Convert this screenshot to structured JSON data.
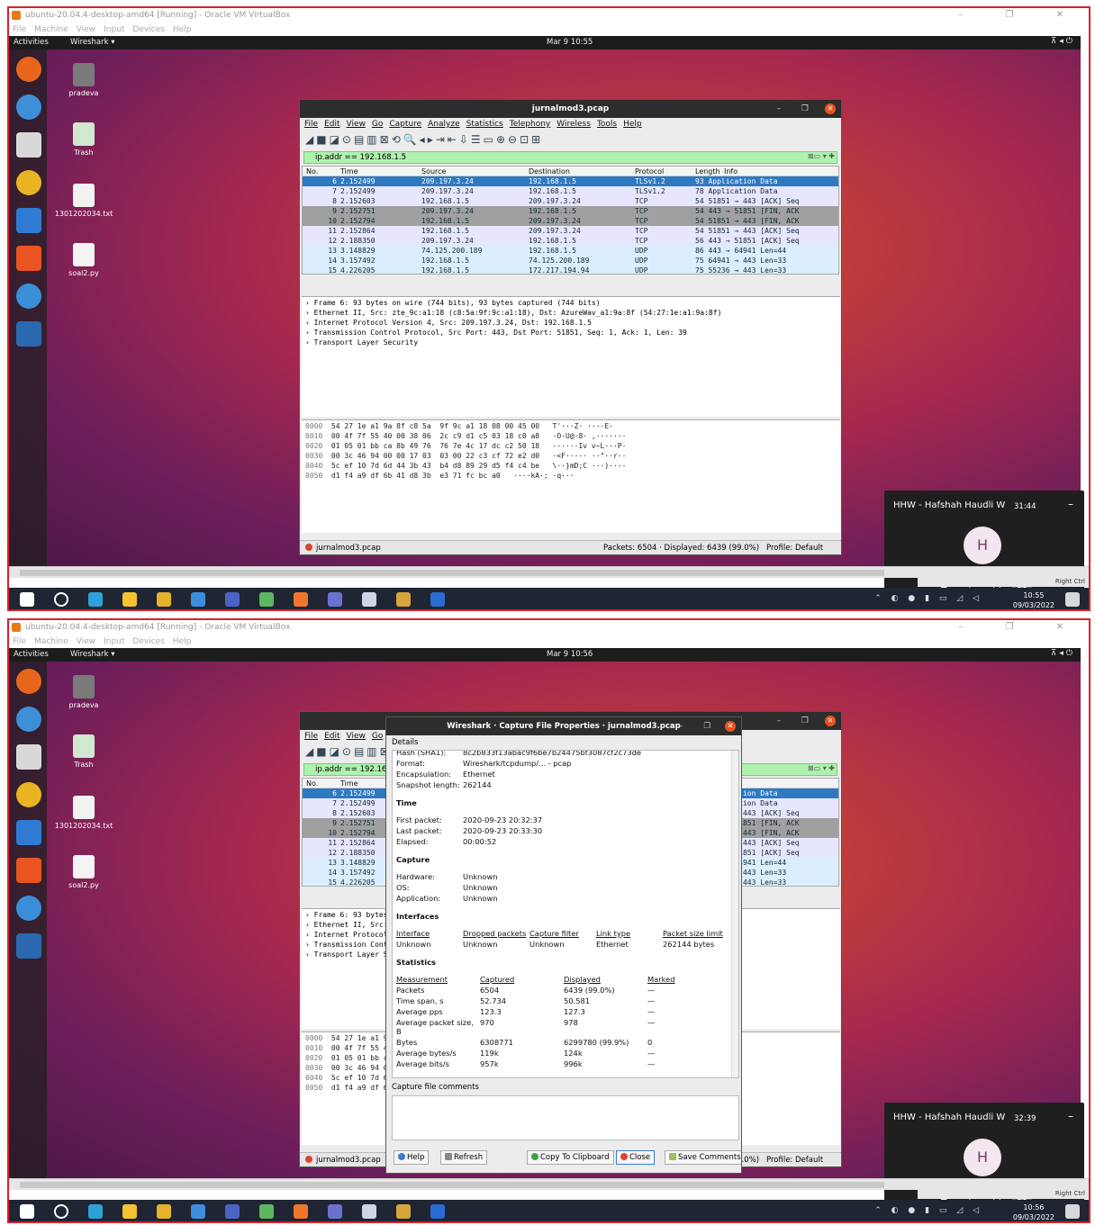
{
  "host": {
    "vbox_menu": [
      "File",
      "Machine",
      "View",
      "Input",
      "Devices",
      "Help"
    ],
    "vm_status_right": "Right Ctrl"
  },
  "screens": [
    {
      "vbox_title": "ubuntu-20.04.4-desktop-amd64 [Running] - Oracle VM VirtualBox",
      "topbar": {
        "activities": "Activities",
        "app_menu": "Wireshark ▾",
        "clock": "Mar 9  10:55"
      },
      "call": {
        "name": "HHW - Hafshah Haudli W",
        "time": "31:44",
        "initial": "H"
      },
      "taskbar": {
        "time": "10:55",
        "date": "09/03/2022"
      }
    },
    {
      "vbox_title": "ubuntu-20.04.4-desktop-amd64 [Running] - Oracle VM VirtualBox",
      "topbar": {
        "activities": "Activities",
        "app_menu": "Wireshark ▾",
        "clock": "Mar 9  10:56"
      },
      "call": {
        "name": "HHW - Hafshah Haudli W",
        "time": "32:39",
        "initial": "H"
      },
      "taskbar": {
        "time": "10:56",
        "date": "09/03/2022"
      }
    }
  ],
  "desktop_icons": [
    {
      "label": "pradeva",
      "icon": "home-folder-icon"
    },
    {
      "label": "Trash",
      "icon": "trash-icon"
    },
    {
      "label": "1301202034.txt",
      "icon": "text-file-icon"
    },
    {
      "label": "soal2.py",
      "icon": "python-file-icon"
    }
  ],
  "wireshark": {
    "title": "jurnalmod3.pcap",
    "menu": [
      "File",
      "Edit",
      "View",
      "Go",
      "Capture",
      "Analyze",
      "Statistics",
      "Telephony",
      "Wireless",
      "Tools",
      "Help"
    ],
    "filter": "ip.addr == 192.168.1.5",
    "columns": [
      "No.",
      "Time",
      "Source",
      "Destination",
      "Protocol",
      "Length",
      "Info"
    ],
    "packets": [
      {
        "no": "6",
        "time": "2.152499",
        "src": "209.197.3.24",
        "dst": "192.168.1.5",
        "proto": "TLSv1.2",
        "info": "93 Application Data",
        "style": "sel"
      },
      {
        "no": "7",
        "time": "2.152499",
        "src": "209.197.3.24",
        "dst": "192.168.1.5",
        "proto": "TLSv1.2",
        "info": "78 Application Data",
        "style": "tcpr"
      },
      {
        "no": "8",
        "time": "2.152603",
        "src": "192.168.1.5",
        "dst": "209.197.3.24",
        "proto": "TCP",
        "info": "54 51851 → 443 [ACK] Seq",
        "style": "tcpr"
      },
      {
        "no": "9",
        "time": "2.152751",
        "src": "209.197.3.24",
        "dst": "192.168.1.5",
        "proto": "TCP",
        "info": "54 443 → 51851 [FIN, ACK",
        "style": "fin"
      },
      {
        "no": "10",
        "time": "2.152794",
        "src": "192.168.1.5",
        "dst": "209.197.3.24",
        "proto": "TCP",
        "info": "54 51851 → 443 [FIN, ACK",
        "style": "fin"
      },
      {
        "no": "11",
        "time": "2.152864",
        "src": "192.168.1.5",
        "dst": "209.197.3.24",
        "proto": "TCP",
        "info": "54 51851 → 443 [ACK] Seq",
        "style": "tcpr"
      },
      {
        "no": "12",
        "time": "2.188350",
        "src": "209.197.3.24",
        "dst": "192.168.1.5",
        "proto": "TCP",
        "info": "56 443 → 51851 [ACK] Seq",
        "style": "tcpr"
      },
      {
        "no": "13",
        "time": "3.148829",
        "src": "74.125.200.189",
        "dst": "192.168.1.5",
        "proto": "UDP",
        "info": "86 443 → 64941 Len=44",
        "style": "udpr"
      },
      {
        "no": "14",
        "time": "3.157492",
        "src": "192.168.1.5",
        "dst": "74.125.200.189",
        "proto": "UDP",
        "info": "75 64941 → 443 Len=33",
        "style": "udpr"
      },
      {
        "no": "15",
        "time": "4.226205",
        "src": "192.168.1.5",
        "dst": "172.217.194.94",
        "proto": "UDP",
        "info": "75 55236 → 443 Len=33",
        "style": "udpr"
      }
    ],
    "details": [
      "Frame 6: 93 bytes on wire (744 bits), 93 bytes captured (744 bits)",
      "Ethernet II, Src: zte_9c:a1:18 (c8:5a:9f:9c:a1:18), Dst: AzureWav_a1:9a:8f (54:27:1e:a1:9a:8f)",
      "Internet Protocol Version 4, Src: 209.197.3.24, Dst: 192.168.1.5",
      "Transmission Control Protocol, Src Port: 443, Dst Port: 51851, Seq: 1, Ack: 1, Len: 39",
      "Transport Layer Security"
    ],
    "bytes": [
      {
        "off": "0000",
        "hex": "54 27 1e a1 9a 8f c8 5a  9f 9c a1 18 08 00 45 00",
        "ascii": "T'···Z· ····E·"
      },
      {
        "off": "0010",
        "hex": "00 4f 7f 55 40 00 38 06  2c c9 d1 c5 03 18 c0 a8",
        "ascii": "·O·U@·8· ,·······"
      },
      {
        "off": "0020",
        "hex": "01 05 01 bb ca 8b 49 76  76 7e 4c 17 dc c2 50 18",
        "ascii": "······Iv v~L···P·"
      },
      {
        "off": "0030",
        "hex": "00 3c 46 94 00 00 17 03  03 00 22 c3 cf 72 e2 d0",
        "ascii": "·<F····· ··\"··r··"
      },
      {
        "off": "0040",
        "hex": "5c ef 10 7d 6d 44 3b 43  b4 d8 89 29 d5 f4 c4 be",
        "ascii": "\\··}mD;C ···)····"
      },
      {
        "off": "0050",
        "hex": "d1 f4 a9 df 6b 41 d8 3b  e3 71 fc bc a0",
        "ascii": "····kA·; ·q···"
      }
    ],
    "status": {
      "file": "jurnalmod3.pcap",
      "packets": "Packets: 6504 · Displayed: 6439 (99.0%)",
      "profile": "Profile: Default"
    }
  },
  "properties_dialog": {
    "title": "Wireshark · Capture File Properties · jurnalmod3.pcap",
    "details_label": "Details",
    "file": [
      {
        "k": "Hash (SHA1):",
        "v": "8c2b833f13abac9f6be7b24475bf3087cf2c73de"
      },
      {
        "k": "Format:",
        "v": "Wireshark/tcpdump/... - pcap"
      },
      {
        "k": "Encapsulation:",
        "v": "Ethernet"
      },
      {
        "k": "Snapshot length:",
        "v": "262144"
      }
    ],
    "time_heading": "Time",
    "time": [
      {
        "k": "First packet:",
        "v": "2020-09-23 20:32:37"
      },
      {
        "k": "Last packet:",
        "v": "2020-09-23 20:33:30"
      },
      {
        "k": "Elapsed:",
        "v": "00:00:52"
      }
    ],
    "capture_heading": "Capture",
    "capture": [
      {
        "k": "Hardware:",
        "v": "Unknown"
      },
      {
        "k": "OS:",
        "v": "Unknown"
      },
      {
        "k": "Application:",
        "v": "Unknown"
      }
    ],
    "interfaces_heading": "Interfaces",
    "interfaces_cols": [
      "Interface",
      "Dropped packets",
      "Capture filter",
      "Link type",
      "Packet size limit"
    ],
    "interfaces_row": [
      "Unknown",
      "Unknown",
      "Unknown",
      "Ethernet",
      "262144 bytes"
    ],
    "statistics_heading": "Statistics",
    "stats_cols": [
      "Measurement",
      "Captured",
      "Displayed",
      "Marked"
    ],
    "stats_rows": [
      [
        "Packets",
        "6504",
        "6439 (99.0%)",
        "—"
      ],
      [
        "Time span, s",
        "52.734",
        "50.581",
        "—"
      ],
      [
        "Average pps",
        "123.3",
        "127.3",
        "—"
      ],
      [
        "Average packet size, B",
        "970",
        "978",
        "—"
      ],
      [
        "Bytes",
        "6308771",
        "6299780 (99.9%)",
        "0"
      ],
      [
        "Average bytes/s",
        "119k",
        "124k",
        "—"
      ],
      [
        "Average bits/s",
        "957k",
        "996k",
        "—"
      ]
    ],
    "comments_label": "Capture file comments",
    "buttons": {
      "help": "Help",
      "refresh": "Refresh",
      "copy": "Copy To Clipboard",
      "close": "Close",
      "save": "Save Comments"
    }
  }
}
